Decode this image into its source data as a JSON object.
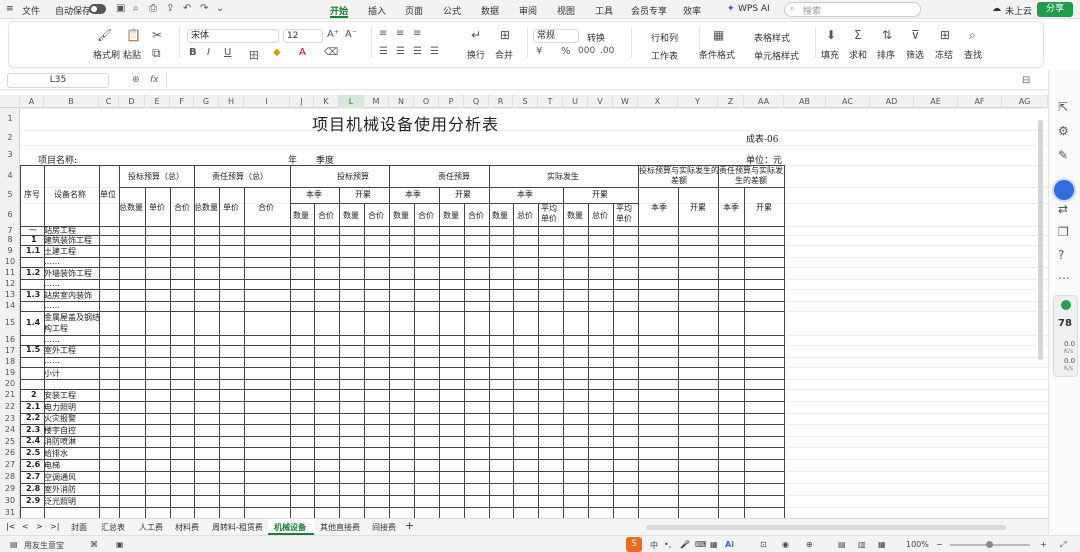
{
  "app": {
    "file_menu": "文件",
    "autosave": "自动保存",
    "accent": "#1a7f37"
  },
  "menu": {
    "items": [
      "开始",
      "插入",
      "页面",
      "公式",
      "数据",
      "审阅",
      "视图",
      "工具",
      "会员专享",
      "效率"
    ],
    "active": "开始",
    "wps_ai": "WPS AI",
    "search_placeholder": "搜索",
    "cloud": "未上云",
    "share": "分享"
  },
  "ribbon": {
    "clipboard": [
      "格式刷",
      "粘贴"
    ],
    "font_name": "宋体",
    "font_size": "12",
    "number_format": "常规",
    "convert": "转换",
    "rows_cols": "行和列",
    "worksheet": "工作表",
    "wrap": "换行",
    "merge": "合并",
    "table_style": "表格样式",
    "cond_format": "条件格式",
    "cell_style": "单元格样式",
    "fill": "填充",
    "sum": "求和",
    "sort": "排序",
    "filter": "筛选",
    "freeze": "冻结",
    "find": "查找"
  },
  "formula": {
    "name_box": "L35",
    "fx": "fx"
  },
  "columns": [
    "A",
    "B",
    "C",
    "D",
    "E",
    "F",
    "G",
    "H",
    "I",
    "J",
    "K",
    "L",
    "M",
    "N",
    "O",
    "P",
    "Q",
    "R",
    "S",
    "T",
    "U",
    "V",
    "W",
    "X",
    "Y",
    "Z",
    "AA",
    "AB",
    "AC",
    "AD",
    "AE",
    "AF",
    "AG"
  ],
  "selected_column": "L",
  "rows": [
    "1",
    "2",
    "3",
    "4",
    "5",
    "6",
    "7",
    "8",
    "9",
    "10",
    "11",
    "12",
    "13",
    "14",
    "15",
    "16",
    "17",
    "18",
    "19",
    "20",
    "21",
    "22",
    "23",
    "24",
    "25",
    "26",
    "27",
    "28",
    "29",
    "30",
    "31"
  ],
  "sheet": {
    "title": "项目机械设备使用分析表",
    "form_no": "成表-06",
    "project_label": "项目名称:",
    "year": "年",
    "quarter": "季度",
    "unit": "单位：元",
    "headers": {
      "seq": "序号",
      "name": "设备名称",
      "unit_col": "单位",
      "bid_total": "投标预算（总）",
      "resp_total": "责任预算（总）",
      "bid_budget": "投标预算",
      "resp_budget": "责任预算",
      "actual": "实际发生",
      "diff_bid": "投标预算与实际发生的差额",
      "diff_resp": "责任预算与实际发生的差额",
      "this_q": "本季",
      "cum": "开累",
      "total_qty": "总数量",
      "unit_price": "单价",
      "total_price": "合价",
      "qty": "数量",
      "amount": "合价",
      "total": "总价",
      "avg_price": "平均单价"
    },
    "items": [
      {
        "no": "一",
        "name": "站房工程"
      },
      {
        "no": "1",
        "name": "建筑装饰工程"
      },
      {
        "no": "1.1",
        "name": "土建工程"
      },
      {
        "no": "",
        "name": "……"
      },
      {
        "no": "1.2",
        "name": "外墙装饰工程"
      },
      {
        "no": "",
        "name": "……"
      },
      {
        "no": "1.3",
        "name": "站房室内装饰"
      },
      {
        "no": "",
        "name": "……"
      },
      {
        "no": "1.4",
        "name": "金属屋盖及钢结构工程"
      },
      {
        "no": "",
        "name": "……"
      },
      {
        "no": "1.5",
        "name": "室外工程"
      },
      {
        "no": "",
        "name": "……"
      },
      {
        "no": "",
        "name": "小计"
      },
      {
        "no": "",
        "name": ""
      },
      {
        "no": "2",
        "name": "安装工程"
      },
      {
        "no": "2.1",
        "name": "电力照明"
      },
      {
        "no": "2.2",
        "name": "火灾报警"
      },
      {
        "no": "2.3",
        "name": "楼宇自控"
      },
      {
        "no": "2.4",
        "name": "消防喷淋"
      },
      {
        "no": "2.5",
        "name": "给排水"
      },
      {
        "no": "2.6",
        "name": "电梯"
      },
      {
        "no": "2.7",
        "name": "空调通风"
      },
      {
        "no": "2.8",
        "name": "室外消防"
      },
      {
        "no": "2.9",
        "name": "泛光照明"
      }
    ]
  },
  "tabs": [
    "封面",
    "汇总表",
    "人工费",
    "材料费",
    "周转料-租赁费",
    "机械设备",
    "其他直接费",
    "间接费"
  ],
  "active_tab": "机械设备",
  "status": {
    "profile": "用友生意宝",
    "zoom": "100%"
  },
  "widget": {
    "value": "78",
    "up": "0.0",
    "down": "0.0",
    "unit": "K/s"
  }
}
